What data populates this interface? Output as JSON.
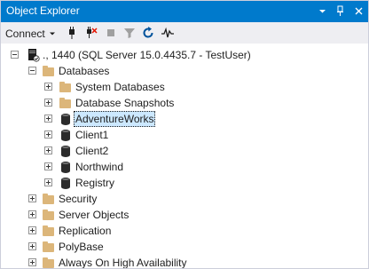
{
  "window": {
    "title": "Object Explorer",
    "buttons": {
      "dropdown": "▾",
      "pin": "ᛁ",
      "close": "✕"
    }
  },
  "toolbar": {
    "connect_label": "Connect",
    "connect_caret": "▾",
    "tools": [
      "connect-icon",
      "disconnect-icon",
      "stop-icon",
      "filter-icon",
      "refresh-icon",
      "activity-monitor-icon"
    ]
  },
  "tree": {
    "server": {
      "label": "., 1440 (SQL Server 15.0.4435.7 - TestUser)",
      "expanded": true
    },
    "databases": {
      "label": "Databases",
      "expanded": true,
      "children": [
        {
          "label": "System Databases",
          "type": "folder"
        },
        {
          "label": "Database Snapshots",
          "type": "folder"
        },
        {
          "label": "AdventureWorks",
          "type": "database",
          "selected": true
        },
        {
          "label": "Client1",
          "type": "database"
        },
        {
          "label": "Client2",
          "type": "database"
        },
        {
          "label": "Northwind",
          "type": "database"
        },
        {
          "label": "Registry",
          "type": "database"
        }
      ]
    },
    "folders": [
      {
        "label": "Security"
      },
      {
        "label": "Server Objects"
      },
      {
        "label": "Replication"
      },
      {
        "label": "PolyBase"
      },
      {
        "label": "Always On High Availability"
      }
    ]
  },
  "colors": {
    "title_bar": "#007acc",
    "toolbar": "#eeeef2",
    "selection": "#cce8ff",
    "folder": "#dcb67a",
    "database": "#2b2b2b"
  }
}
